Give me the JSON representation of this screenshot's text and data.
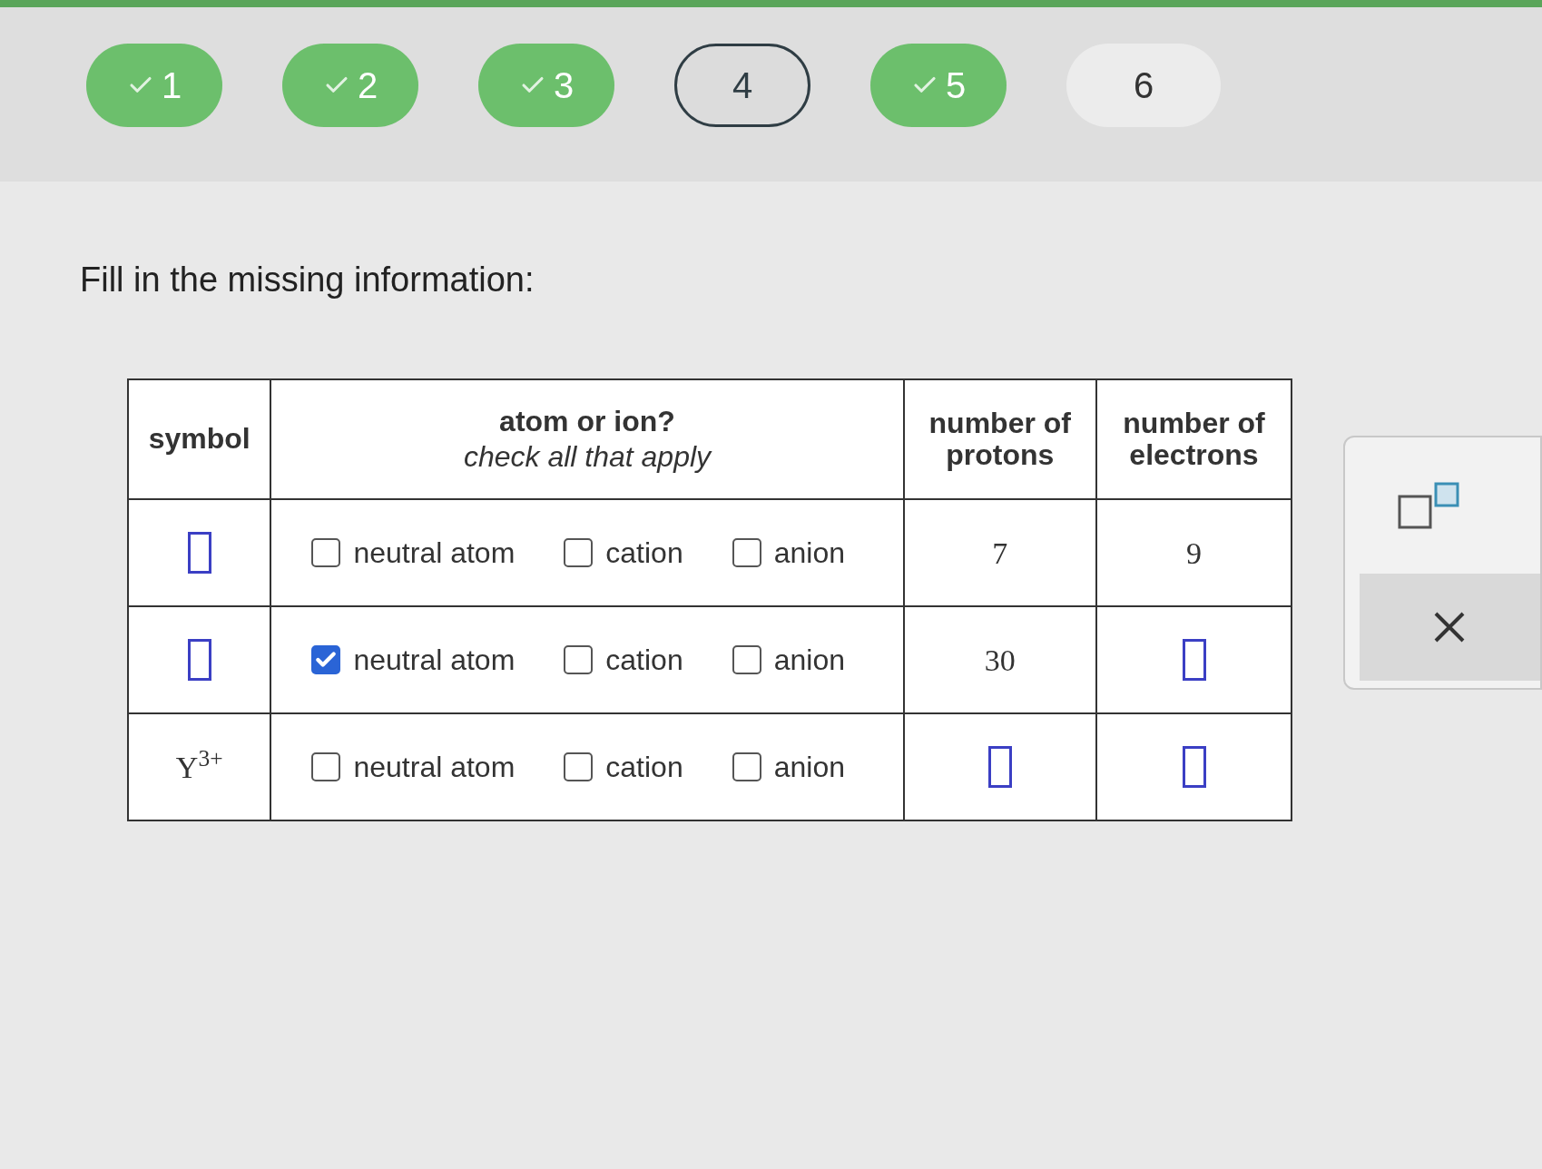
{
  "steps": [
    {
      "label": "1",
      "kind": "done"
    },
    {
      "label": "2",
      "kind": "done"
    },
    {
      "label": "3",
      "kind": "done"
    },
    {
      "label": "4",
      "kind": "current"
    },
    {
      "label": "5",
      "kind": "done"
    },
    {
      "label": "6",
      "kind": "pending"
    }
  ],
  "prompt": "Fill in the missing information:",
  "table": {
    "columns": [
      {
        "title": "symbol"
      },
      {
        "title": "atom or ion?",
        "subtitle": "check all that apply"
      },
      {
        "title": "number of protons"
      },
      {
        "title": "number of electrons"
      }
    ],
    "rows": [
      {
        "symbol": {
          "kind": "blank"
        },
        "options": [
          {
            "label": "neutral atom",
            "checked": false
          },
          {
            "label": "cation",
            "checked": false
          },
          {
            "label": "anion",
            "checked": false
          }
        ],
        "protons": {
          "kind": "text",
          "text": "7"
        },
        "electrons": {
          "kind": "text",
          "text": "9"
        }
      },
      {
        "symbol": {
          "kind": "blank"
        },
        "options": [
          {
            "label": "neutral atom",
            "checked": true
          },
          {
            "label": "cation",
            "checked": false
          },
          {
            "label": "anion",
            "checked": false
          }
        ],
        "protons": {
          "kind": "text",
          "text": "30"
        },
        "electrons": {
          "kind": "blank"
        }
      },
      {
        "symbol": {
          "kind": "text",
          "text": "Y$^{3+}$"
        },
        "options": [
          {
            "label": "neutral atom",
            "checked": false
          },
          {
            "label": "cation",
            "checked": false
          },
          {
            "label": "anion",
            "checked": false
          }
        ],
        "protons": {
          "kind": "blank"
        },
        "electrons": {
          "kind": "blank"
        }
      }
    ]
  }
}
